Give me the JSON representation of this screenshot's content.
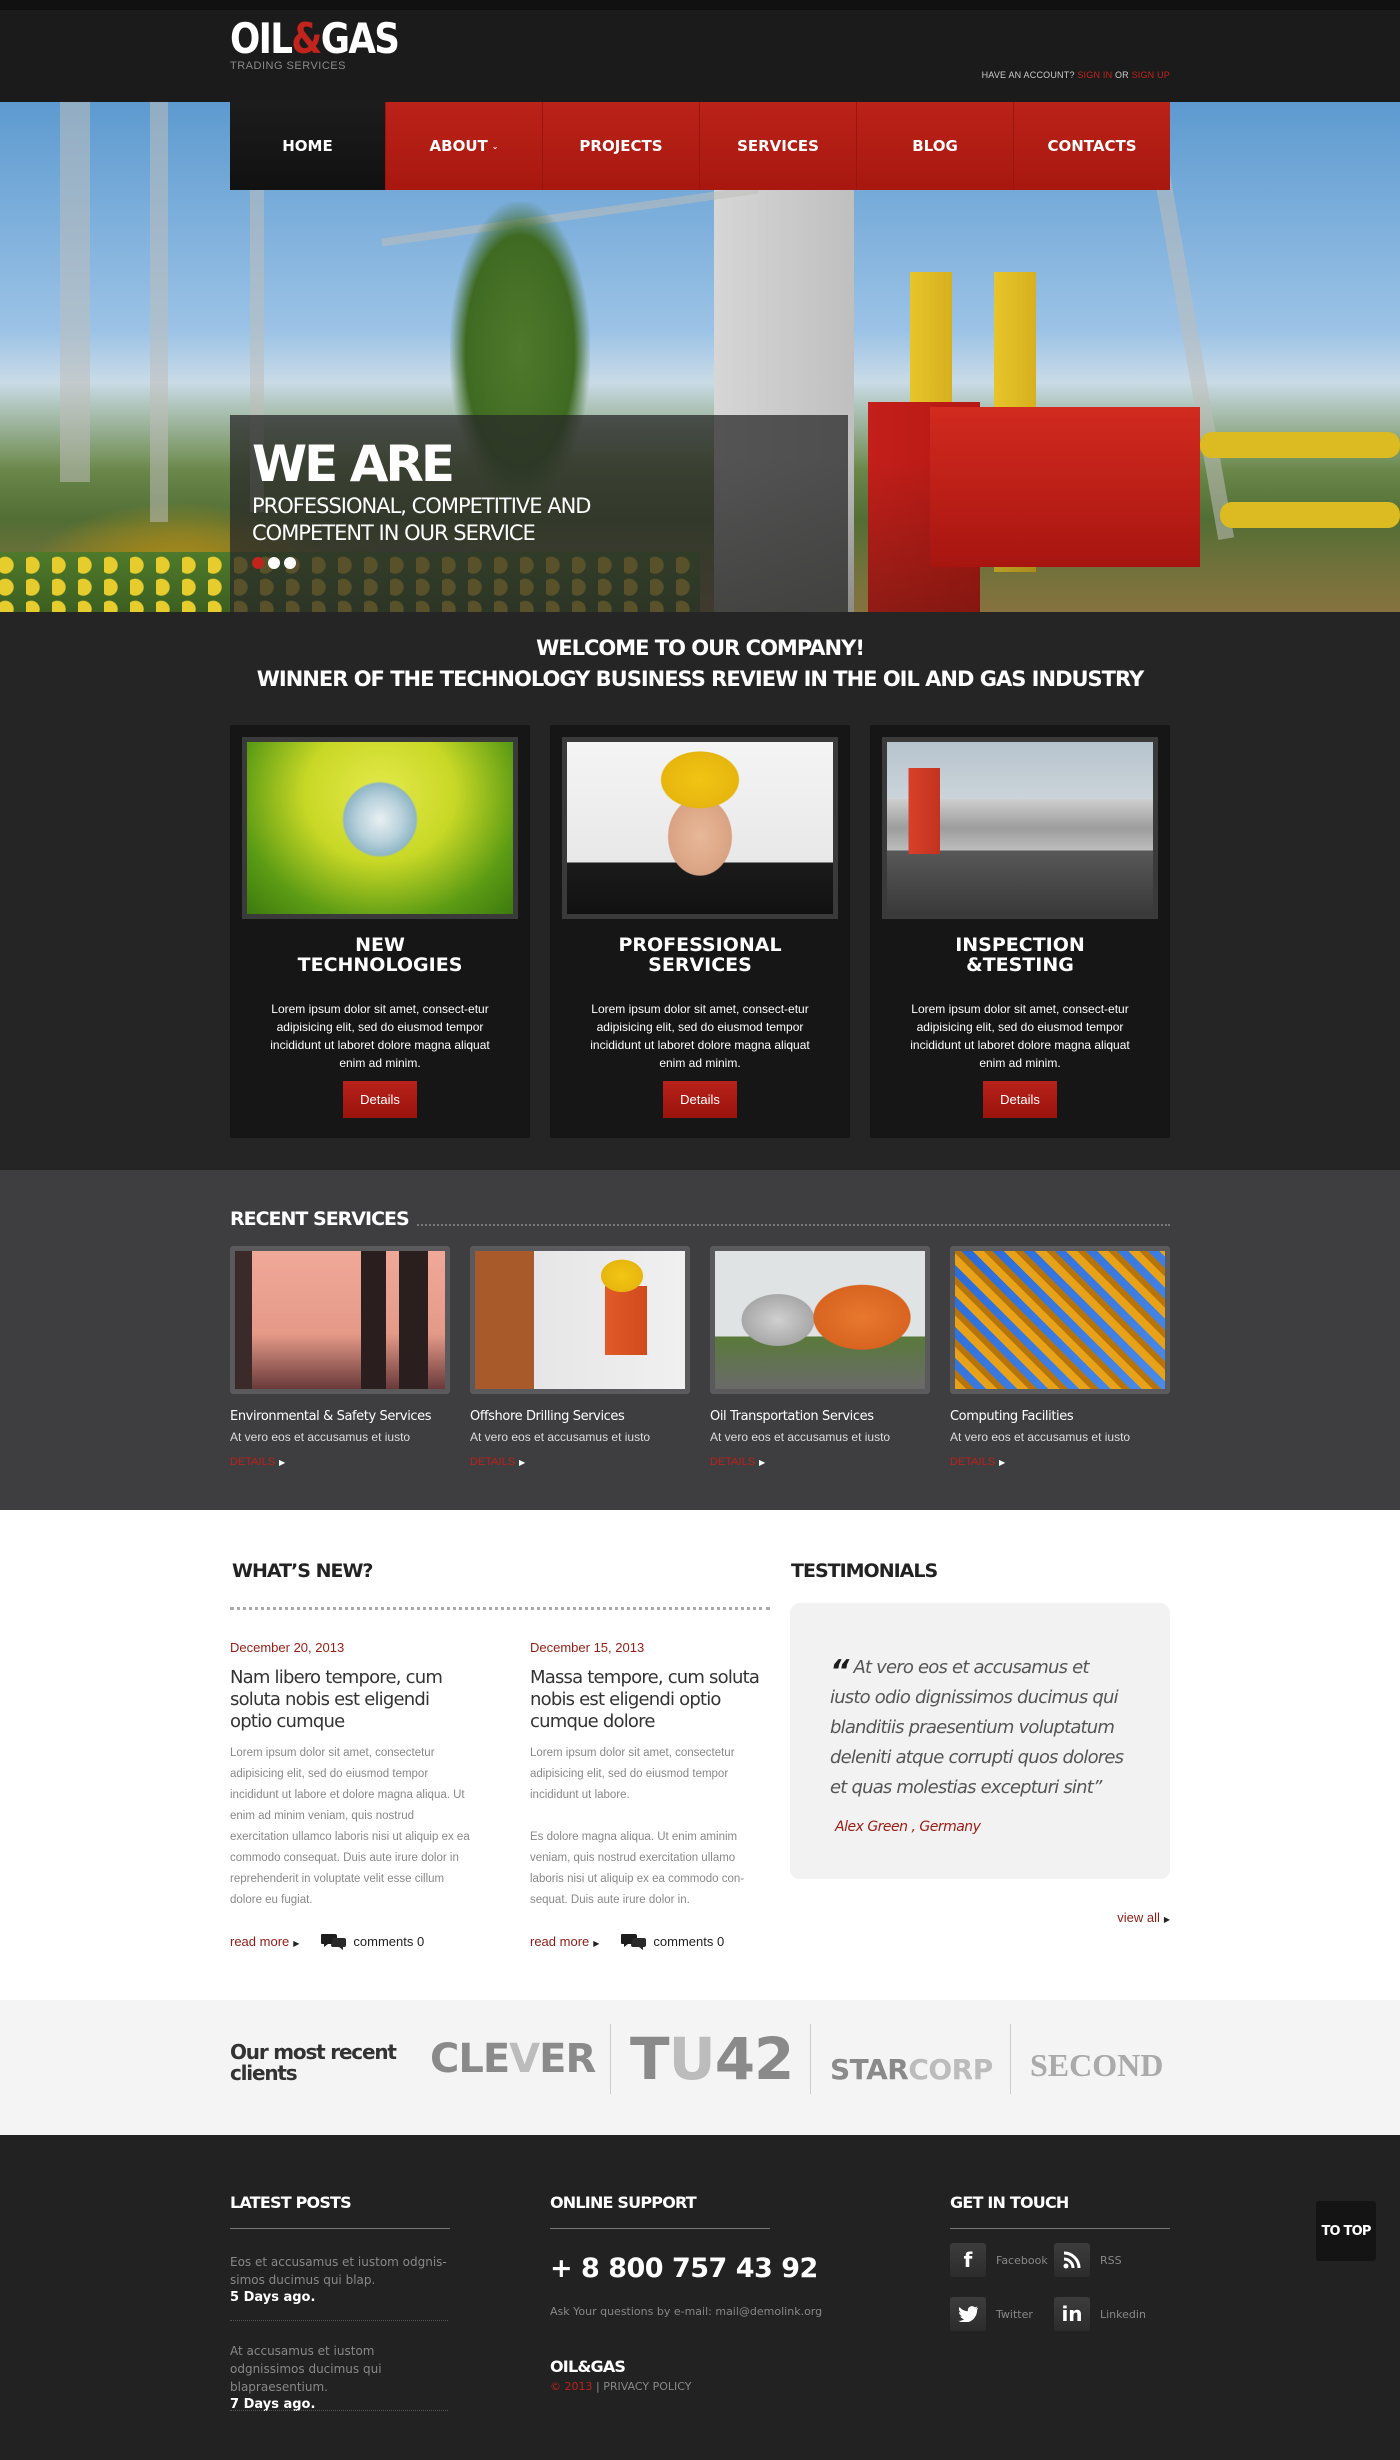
{
  "brand": {
    "name_part1": "OIL",
    "name_amp": "&",
    "name_part2": "GAS",
    "tagline": "TRADING SERVICES"
  },
  "account": {
    "prompt": "HAVE AN ACCOUNT?",
    "sign_in": "SIGN IN",
    "or": "OR",
    "sign_up": "SIGN UP"
  },
  "nav": {
    "items": [
      {
        "label": "HOME",
        "active": true
      },
      {
        "label": "ABOUT",
        "has_dropdown": true
      },
      {
        "label": "PROJECTS"
      },
      {
        "label": "SERVICES"
      },
      {
        "label": "BLOG"
      },
      {
        "label": "CONTACTS"
      }
    ],
    "caret": "⌄"
  },
  "hero": {
    "heading": "WE ARE",
    "subheading": "PROFESSIONAL, COMPETITIVE AND COMPETENT IN OUR SERVICE",
    "slides_total": 3,
    "slide_active": 1
  },
  "welcome": {
    "line1": "WELCOME TO OUR COMPANY!",
    "line2": "WINNER OF THE TECHNOLOGY BUSINESS REVIEW IN THE OIL AND GAS INDUSTRY",
    "cards": [
      {
        "title_l1": "NEW",
        "title_l2": "TECHNOLOGIES",
        "text": "Lorem ipsum dolor sit amet, consect-etur adipisicing elit, sed do eiusmod tempor incididunt ut laboret dolore magna aliquat enim ad minim.",
        "button": "Details",
        "image": "globe-in-grass"
      },
      {
        "title_l1": "PROFESSIONAL",
        "title_l2": "SERVICES",
        "text": "Lorem ipsum dolor sit amet, consect-etur adipisicing elit, sed do eiusmod tempor incididunt ut laboret dolore magna aliquat enim ad minim.",
        "button": "Details",
        "image": "worker-in-hardhat"
      },
      {
        "title_l1": "INSPECTION",
        "title_l2": "&TESTING",
        "text": "Lorem ipsum dolor sit amet, consect-etur adipisicing elit, sed do eiusmod tempor incididunt ut laboret dolore magna aliquat enim ad minim.",
        "button": "Details",
        "image": "tanker-truck"
      }
    ]
  },
  "recent_services": {
    "title": "RECENT SERVICES",
    "items": [
      {
        "title": "Environmental & Safety Services",
        "text": "At vero eos et accusamus et iusto",
        "link": "DETAILS",
        "image": "refinery-towers"
      },
      {
        "title": "Offshore Drilling Services",
        "text": "At vero eos et accusamus et iusto",
        "link": "DETAILS",
        "image": "worker-on-rig"
      },
      {
        "title": "Oil Transportation Services",
        "text": "At vero eos et accusamus et iusto",
        "link": "DETAILS",
        "image": "orange-tanker"
      },
      {
        "title": "Computing Facilities",
        "text": "At vero eos et accusamus et iusto",
        "link": "DETAILS",
        "image": "crane-structure"
      }
    ]
  },
  "whats_new": {
    "title": "WHAT’S NEW?",
    "posts": [
      {
        "date": "December 20, 2013",
        "title": "Nam libero tempore, cum soluta nobis est eligendi optio cumque",
        "body": "Lorem ipsum dolor sit amet, consectetur adipisicing elit, sed do eiusmod tempor incididunt ut labore et dolore magna aliqua. Ut enim ad minim veniam, quis nostrud exercitation ullamco laboris nisi ut aliquip ex ea commodo consequat. Duis aute irure dolor in reprehenderit in voluptate velit esse cillum dolore eu fugiat.",
        "read_more": "read more",
        "comments": "comments 0"
      },
      {
        "date": "December 15, 2013",
        "title": "Massa tempore, cum soluta nobis est eligendi optio cumque dolore",
        "body": "Lorem ipsum dolor sit amet, consectetur adipisicing elit, sed do eiusmod tempor incididunt ut labore.\n\nEs dolore magna aliqua. Ut enim aminim veniam, quis nostrud exercitation ullamo laboris nisi ut aliquip ex ea commodo con-sequat. Duis aute irure dolor in.",
        "read_more": "read more",
        "comments": "comments 0"
      }
    ]
  },
  "testimonials": {
    "title": "TESTIMONIALS",
    "open_quote": "“",
    "quote": "At vero eos et accusamus et iusto odio dignissimos ducimus qui blanditiis praesentium voluptatum deleniti atque corrupti quos dolores et quas molestias excepturi sint”",
    "author": "Alex Green ,  Germany",
    "view_all": "view all"
  },
  "clients": {
    "label_l1": "Our most recent",
    "label_l2": "clients",
    "logos": [
      {
        "a": "CLE",
        "b": "V",
        "c": "ER"
      },
      {
        "a": "T",
        "b": "U",
        "c": "42"
      },
      {
        "a": "STAR",
        "b": "CORP",
        "c": ""
      },
      {
        "a": "SECOND",
        "b": "",
        "c": ""
      }
    ]
  },
  "footer": {
    "latest_posts": {
      "title": "LATEST POSTS",
      "items": [
        {
          "text": "Eos et accusamus et iustom odgnis-simos ducimus qui blap.",
          "age": "5 Days ago."
        },
        {
          "text": "At accusamus et iustom odgnissimos ducimus qui blapraesentium.",
          "age": "7 Days ago."
        }
      ]
    },
    "online_support": {
      "title": "ONLINE SUPPORT",
      "phone": "+ 8 800 757 43 92",
      "ask": "Ask Your questions by e-mail: mail@demolink.org",
      "brand": "OIL&GAS",
      "copyright": "© 2013",
      "separator": "|",
      "privacy": "PRIVACY POLICY"
    },
    "get_in_touch": {
      "title": "GET IN TOUCH",
      "links": [
        {
          "label": "Facebook",
          "icon": "facebook-icon",
          "glyph": "f"
        },
        {
          "label": "RSS",
          "icon": "rss-icon",
          "glyph": "≋"
        },
        {
          "label": "Twitter",
          "icon": "twitter-icon",
          "glyph": "🐦"
        },
        {
          "label": "Linkedin",
          "icon": "linkedin-icon",
          "glyph": "in"
        }
      ]
    },
    "to_top": "TO TOP"
  },
  "colors": {
    "accent": "#c1241c",
    "dark": "#1d1d1d",
    "panel": "#161616",
    "recent_bg": "#3e3e40"
  }
}
